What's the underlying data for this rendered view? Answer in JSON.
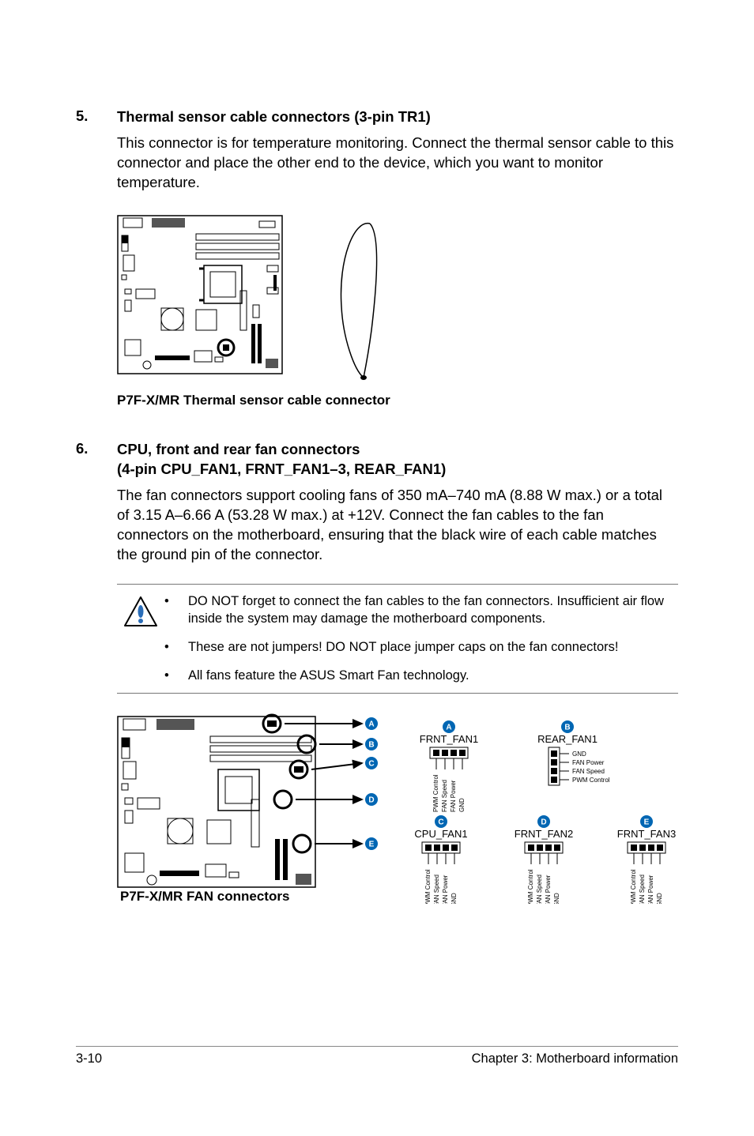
{
  "sections": {
    "s5": {
      "num": "5.",
      "title": "Thermal sensor cable connectors (3-pin TR1)",
      "body": "This connector is for temperature monitoring. Connect the thermal sensor cable to this connector and place the other end to the device, which you want to monitor temperature.",
      "caption": "P7F-X/MR Thermal sensor cable connector"
    },
    "s6": {
      "num": "6.",
      "title_l1": "CPU, front and rear fan connectors",
      "title_l2": "(4-pin CPU_FAN1, FRNT_FAN1–3, REAR_FAN1)",
      "body": "The fan connectors support cooling fans of 350 mA–740 mA (8.88 W max.) or a total of 3.15 A–6.66 A (53.28 W max.) at +12V. Connect the fan cables to the fan connectors on the motherboard, ensuring that the black wire of each cable matches the ground pin of the connector.",
      "warn": {
        "b1": "DO NOT forget to connect the fan cables to the fan connectors. Insufficient air flow inside the system may damage the motherboard components.",
        "b2": "These are not jumpers! DO NOT place jumper caps on the fan connectors!",
        "b3": "All fans feature the ASUS Smart Fan technology."
      },
      "caption": "P7F-X/MR FAN connectors",
      "conn": {
        "frnt_fan1": "FRNT_FAN1",
        "rear_fan1": "REAR_FAN1",
        "cpu_fan1": "CPU_FAN1",
        "frnt_fan2": "FRNT_FAN2",
        "frnt_fan3": "FRNT_FAN3"
      },
      "pins4": {
        "p1": "PWM Control",
        "p2": "FAN Speed",
        "p3": "FAN Power",
        "p4": "GND"
      },
      "pins4h": {
        "p1": "GND",
        "p2": "FAN Power",
        "p3": "FAN Speed",
        "p4": "PWM Control"
      },
      "markers": {
        "a": "A",
        "b": "B",
        "c": "C",
        "d": "D",
        "e": "E"
      }
    }
  },
  "footer": {
    "left": "3-10",
    "right": "Chapter 3: Motherboard information"
  },
  "bullet": "•"
}
